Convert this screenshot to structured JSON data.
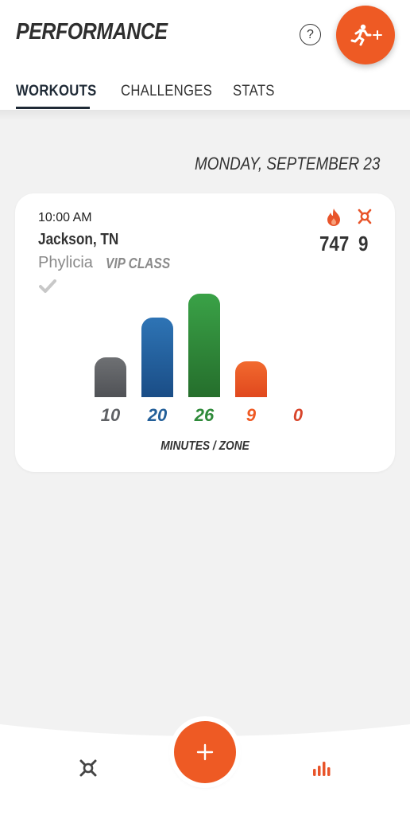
{
  "header": {
    "title": "PERFORMANCE",
    "help_glyph": "?",
    "help_icon": "help-circle-icon",
    "add_workout_icon": "runner-plus-icon"
  },
  "tabs": [
    {
      "label": "WORKOUTS",
      "active": true
    },
    {
      "label": "CHALLENGES",
      "active": false
    },
    {
      "label": "STATS",
      "active": false
    }
  ],
  "date": "MONDAY, SEPTEMBER 23",
  "workout": {
    "time": "10:00 AM",
    "location": "Jackson, TN",
    "coach": "Phylicia",
    "class_type": "VIP CLASS",
    "completed_icon": "checkmark-icon",
    "calories": "747",
    "splat_points": "9",
    "calories_icon": "flame-icon",
    "splat_icon": "splat-logo-icon",
    "zone_label": "MINUTES / ZONE"
  },
  "chart_data": {
    "type": "bar",
    "categories": [
      "gray",
      "blue",
      "green",
      "orange",
      "red"
    ],
    "values": [
      10,
      20,
      26,
      9,
      0
    ],
    "labels": [
      "10",
      "20",
      "26",
      "9",
      "0"
    ],
    "xlabel": "MINUTES / ZONE",
    "colors": [
      "#5f6165",
      "#235f99",
      "#2f8a3a",
      "#ef5a24",
      "#d8452b"
    ]
  },
  "colors": {
    "accent": "#ee5a24",
    "text_dark": "#1f2a36"
  },
  "bottom_nav": {
    "home_icon": "splat-logo-icon",
    "add_icon": "plus-icon",
    "stats_icon": "bar-chart-icon"
  }
}
